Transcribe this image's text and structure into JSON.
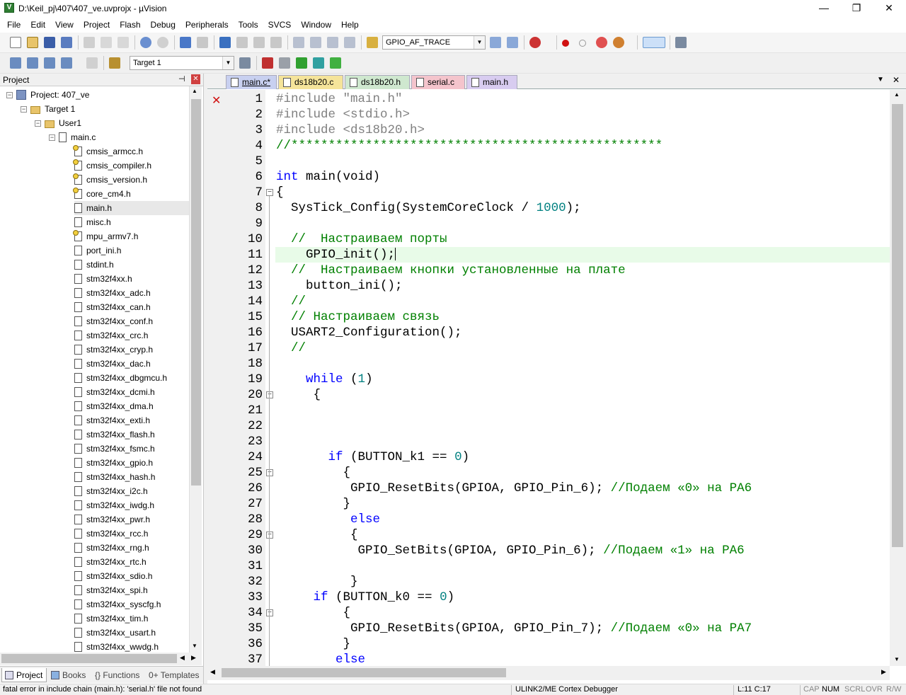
{
  "window": {
    "title": "D:\\Keil_pj\\407\\407_ve.uvprojx - µVision",
    "app_icon_letter": "V",
    "minimize": "—",
    "restore": "❐",
    "close": "✕"
  },
  "menu": [
    "File",
    "Edit",
    "View",
    "Project",
    "Flash",
    "Debug",
    "Peripherals",
    "Tools",
    "SVCS",
    "Window",
    "Help"
  ],
  "toolbar": {
    "find_combo_value": "GPIO_AF_TRACE",
    "target_combo_value": "Target 1"
  },
  "project_panel": {
    "title": "Project",
    "pin": "⊣",
    "close": "✕",
    "root": "Project: 407_ve",
    "target": "Target 1",
    "group": "User1",
    "file": "main.c",
    "headers": [
      "cmsis_armcc.h",
      "cmsis_compiler.h",
      "cmsis_version.h",
      "core_cm4.h",
      "main.h",
      "misc.h",
      "mpu_armv7.h",
      "port_ini.h",
      "stdint.h",
      "stm32f4xx.h",
      "stm32f4xx_adc.h",
      "stm32f4xx_can.h",
      "stm32f4xx_conf.h",
      "stm32f4xx_crc.h",
      "stm32f4xx_cryp.h",
      "stm32f4xx_dac.h",
      "stm32f4xx_dbgmcu.h",
      "stm32f4xx_dcmi.h",
      "stm32f4xx_dma.h",
      "stm32f4xx_exti.h",
      "stm32f4xx_flash.h",
      "stm32f4xx_fsmc.h",
      "stm32f4xx_gpio.h",
      "stm32f4xx_hash.h",
      "stm32f4xx_i2c.h",
      "stm32f4xx_iwdg.h",
      "stm32f4xx_pwr.h",
      "stm32f4xx_rcc.h",
      "stm32f4xx_rng.h",
      "stm32f4xx_rtc.h",
      "stm32f4xx_sdio.h",
      "stm32f4xx_spi.h",
      "stm32f4xx_syscfg.h",
      "stm32f4xx_tim.h",
      "stm32f4xx_usart.h",
      "stm32f4xx_wwdg.h"
    ],
    "bottom_tabs": [
      "Project",
      "Books",
      "{} Functions",
      "0+ Templates"
    ]
  },
  "editor_tabs": [
    {
      "label": "main.c*",
      "color": "#c8d0f0"
    },
    {
      "label": "ds18b20.c",
      "color": "#f5e49a"
    },
    {
      "label": "ds18b20.h",
      "color": "#cfe8cf"
    },
    {
      "label": "serial.c",
      "color": "#f4c4cc"
    },
    {
      "label": "main.h",
      "color": "#d8ccf0"
    }
  ],
  "code_lines": [
    {
      "n": "1",
      "segs": [
        {
          "c": "pp",
          "t": "#include \"main.h\""
        }
      ]
    },
    {
      "n": "2",
      "segs": [
        {
          "c": "pp",
          "t": "#include <stdio.h>"
        }
      ]
    },
    {
      "n": "3",
      "segs": [
        {
          "c": "pp",
          "t": "#include <ds18b20.h>"
        }
      ]
    },
    {
      "n": "4",
      "segs": [
        {
          "c": "cm",
          "t": "//**************************************************"
        }
      ]
    },
    {
      "n": "5",
      "segs": []
    },
    {
      "n": "6",
      "segs": [
        {
          "c": "kw",
          "t": "int"
        },
        {
          "c": "",
          "t": " main(void)"
        }
      ]
    },
    {
      "n": "7",
      "segs": [
        {
          "c": "",
          "t": "{"
        }
      ]
    },
    {
      "n": "8",
      "segs": [
        {
          "c": "",
          "t": "  SysTick_Config(SystemCoreClock / "
        },
        {
          "c": "num",
          "t": "1000"
        },
        {
          "c": "",
          "t": ");"
        }
      ]
    },
    {
      "n": "9",
      "segs": []
    },
    {
      "n": "10",
      "segs": [
        {
          "c": "cm",
          "t": "  //  Настраиваем порты"
        }
      ]
    },
    {
      "n": "11",
      "segs": [
        {
          "c": "",
          "t": "    GPIO_init();"
        }
      ]
    },
    {
      "n": "12",
      "segs": [
        {
          "c": "cm",
          "t": "  //  Настраиваем кнопки установленные на плате"
        }
      ]
    },
    {
      "n": "13",
      "segs": [
        {
          "c": "",
          "t": "    button_ini();"
        }
      ]
    },
    {
      "n": "14",
      "segs": [
        {
          "c": "cm",
          "t": "  //"
        }
      ]
    },
    {
      "n": "15",
      "segs": [
        {
          "c": "cm",
          "t": "  // Настраиваем связь"
        }
      ]
    },
    {
      "n": "16",
      "segs": [
        {
          "c": "",
          "t": "  USART2_Configuration();"
        }
      ]
    },
    {
      "n": "17",
      "segs": [
        {
          "c": "cm",
          "t": "  //"
        }
      ]
    },
    {
      "n": "18",
      "segs": []
    },
    {
      "n": "19",
      "segs": [
        {
          "c": "",
          "t": "    "
        },
        {
          "c": "kw",
          "t": "while"
        },
        {
          "c": "",
          "t": " ("
        },
        {
          "c": "num",
          "t": "1"
        },
        {
          "c": "",
          "t": ")"
        }
      ]
    },
    {
      "n": "20",
      "segs": [
        {
          "c": "",
          "t": "     {"
        }
      ]
    },
    {
      "n": "21",
      "segs": []
    },
    {
      "n": "22",
      "segs": []
    },
    {
      "n": "23",
      "segs": []
    },
    {
      "n": "24",
      "segs": [
        {
          "c": "",
          "t": "       "
        },
        {
          "c": "kw",
          "t": "if"
        },
        {
          "c": "",
          "t": " (BUTTON_k1 == "
        },
        {
          "c": "num",
          "t": "0"
        },
        {
          "c": "",
          "t": ")"
        }
      ]
    },
    {
      "n": "25",
      "segs": [
        {
          "c": "",
          "t": "         {"
        }
      ]
    },
    {
      "n": "26",
      "segs": [
        {
          "c": "",
          "t": "          GPIO_ResetBits(GPIOA, GPIO_Pin_6); "
        },
        {
          "c": "cm",
          "t": "//Подаем «0» на PA6"
        }
      ]
    },
    {
      "n": "27",
      "segs": [
        {
          "c": "",
          "t": "         }"
        }
      ]
    },
    {
      "n": "28",
      "segs": [
        {
          "c": "",
          "t": "          "
        },
        {
          "c": "kw",
          "t": "else"
        }
      ]
    },
    {
      "n": "29",
      "segs": [
        {
          "c": "",
          "t": "          {"
        }
      ]
    },
    {
      "n": "30",
      "segs": [
        {
          "c": "",
          "t": "           GPIO_SetBits(GPIOA, GPIO_Pin_6); "
        },
        {
          "c": "cm",
          "t": "//Подаем «1» на PA6"
        }
      ]
    },
    {
      "n": "31",
      "segs": []
    },
    {
      "n": "32",
      "segs": [
        {
          "c": "",
          "t": "          }"
        }
      ]
    },
    {
      "n": "33",
      "segs": [
        {
          "c": "",
          "t": "     "
        },
        {
          "c": "kw",
          "t": "if"
        },
        {
          "c": "",
          "t": " (BUTTON_k0 == "
        },
        {
          "c": "num",
          "t": "0"
        },
        {
          "c": "",
          "t": ")"
        }
      ]
    },
    {
      "n": "34",
      "segs": [
        {
          "c": "",
          "t": "         {"
        }
      ]
    },
    {
      "n": "35",
      "segs": [
        {
          "c": "",
          "t": "          GPIO_ResetBits(GPIOA, GPIO_Pin_7); "
        },
        {
          "c": "cm",
          "t": "//Подаем «0» на PA7"
        }
      ]
    },
    {
      "n": "36",
      "segs": [
        {
          "c": "",
          "t": "         }"
        }
      ]
    },
    {
      "n": "37",
      "segs": [
        {
          "c": "",
          "t": "        "
        },
        {
          "c": "kw",
          "t": "else"
        }
      ]
    }
  ],
  "status": {
    "message": "fatal error in include chain (main.h): 'serial.h' file not found",
    "debugger": "ULINK2/ME Cortex Debugger",
    "position": "L:11 C:17",
    "cap": "CAP",
    "num": "NUM",
    "scrl": "SCRL",
    "ovr": "OVR",
    "rw": "R/W"
  }
}
